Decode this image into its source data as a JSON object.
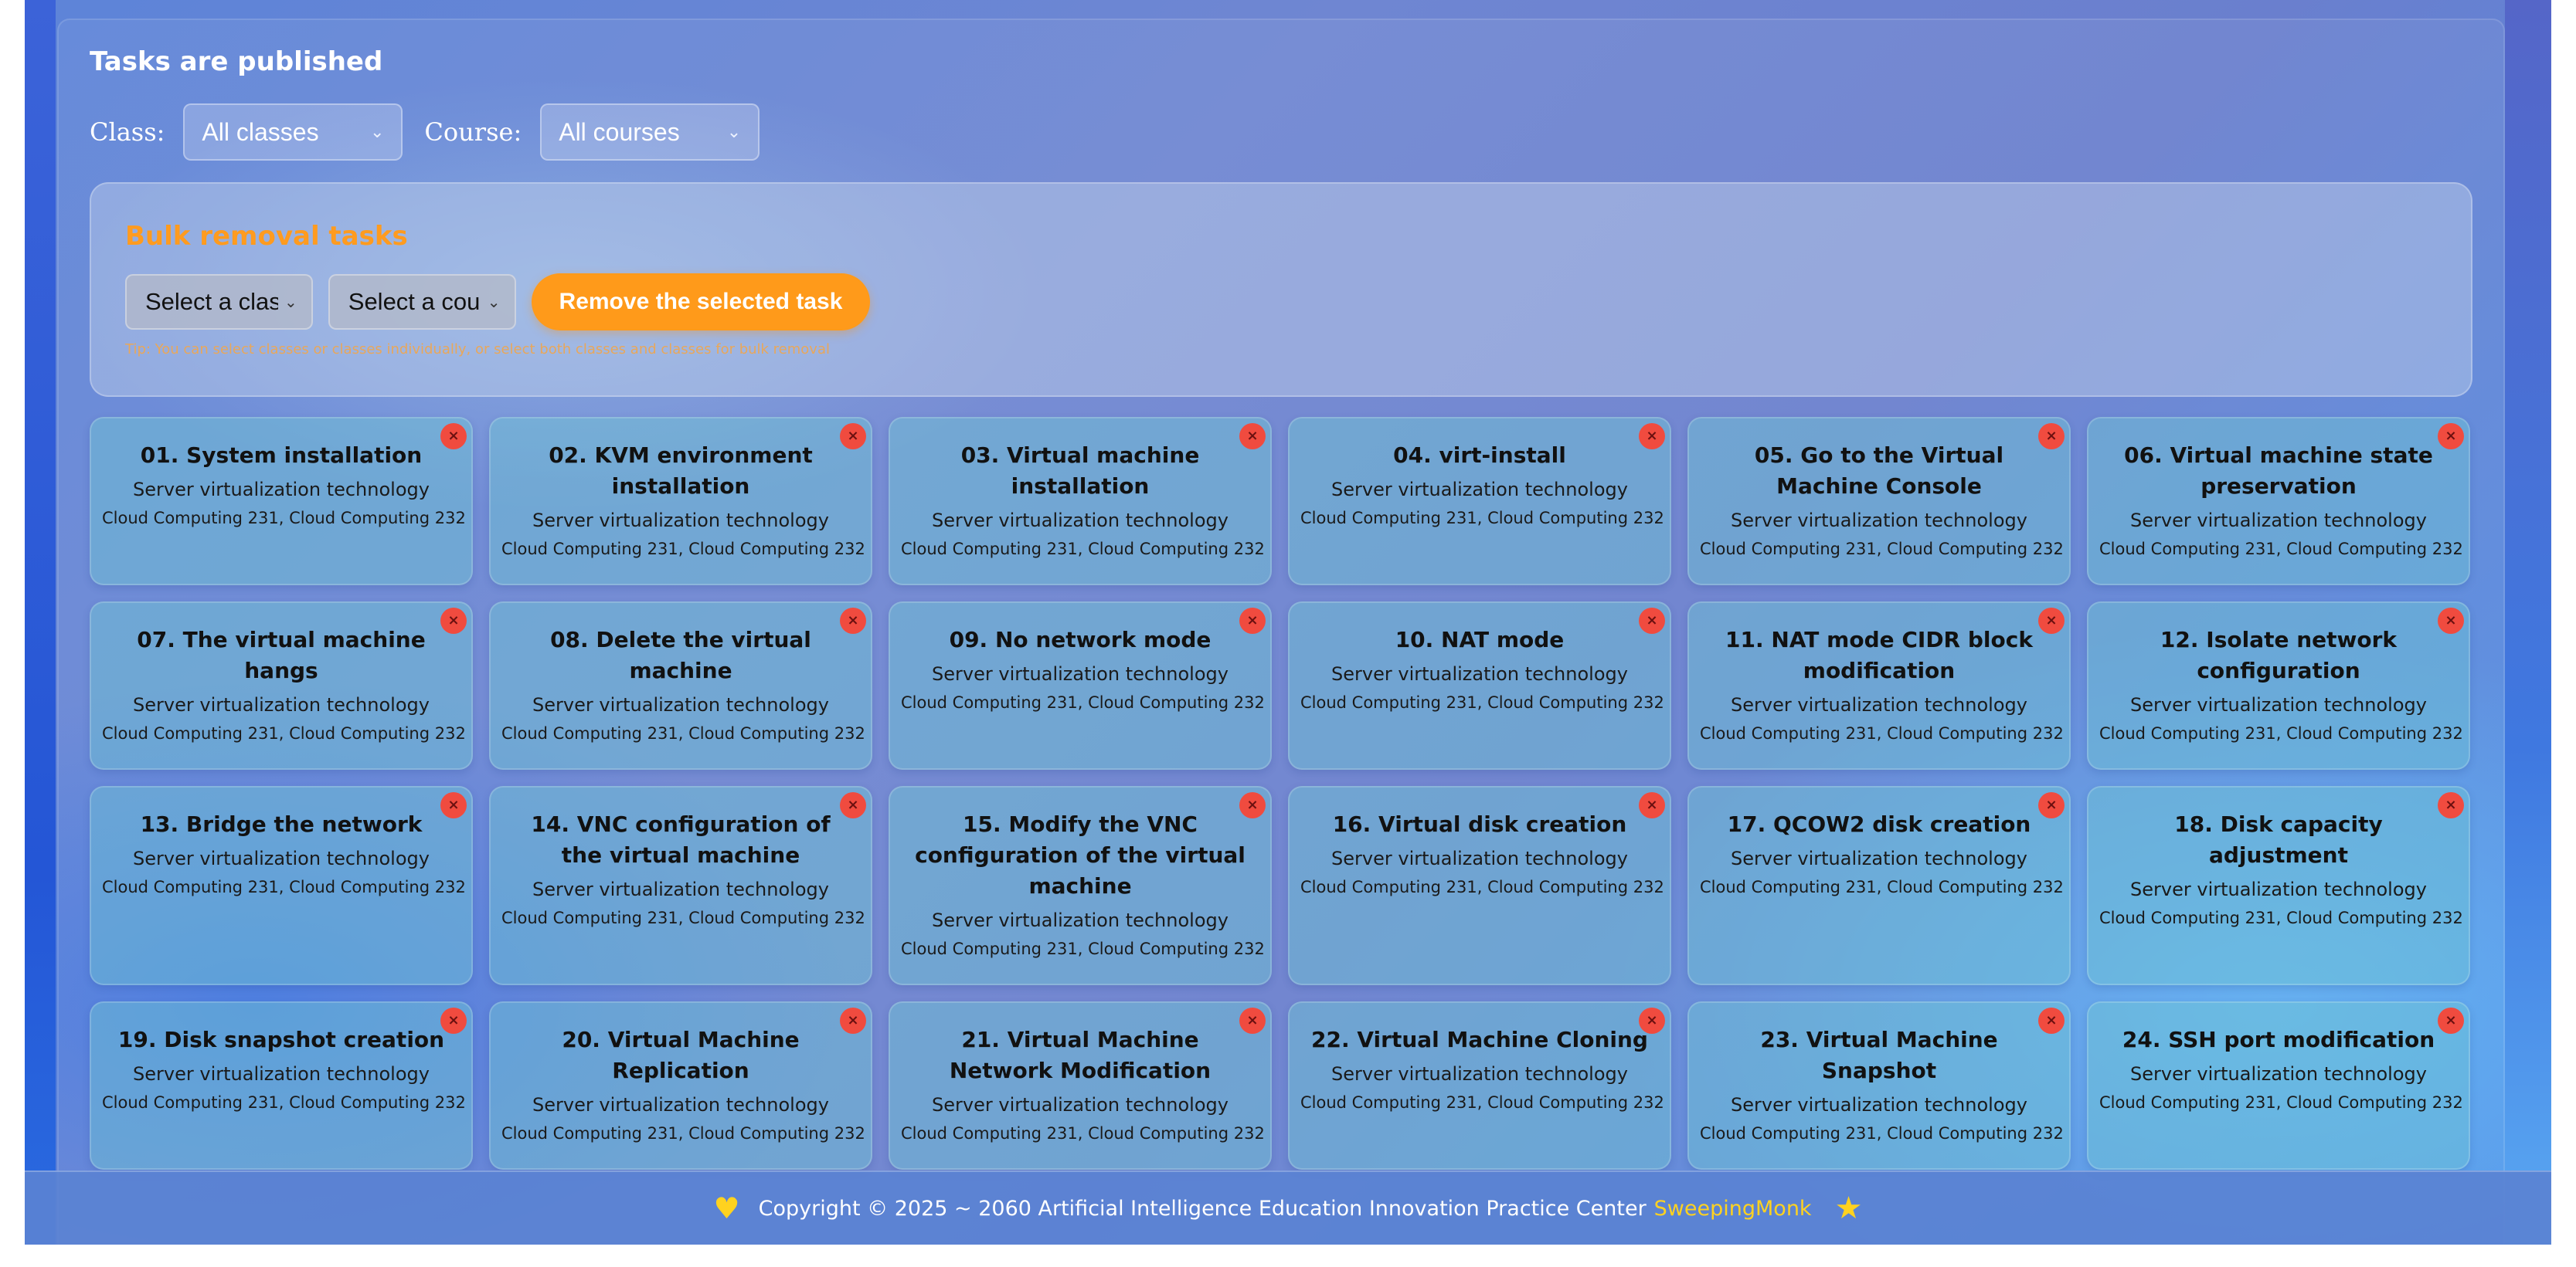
{
  "header": {
    "title": "Tasks are published",
    "class_label": "Class:",
    "class_value": "All classes",
    "course_label": "Course:",
    "course_value": "All courses"
  },
  "bulk": {
    "title": "Bulk removal tasks",
    "class_placeholder": "Select a clas",
    "course_placeholder": "Select a cou",
    "remove_label": "Remove the selected task",
    "tip": "Tip: You can select classes or classes individually, or select both classes and classes for bulk removal"
  },
  "colors": {
    "accent": "#ff9a1a",
    "delete": "#f04b3f",
    "brand": "#ffd21f"
  },
  "tasks": [
    {
      "title": "01. System installation",
      "course": "Server virtualization technology",
      "classes": "Cloud Computing 231, Cloud Computing 232"
    },
    {
      "title": "02. KVM environment installation",
      "course": "Server virtualization technology",
      "classes": "Cloud Computing 231, Cloud Computing 232"
    },
    {
      "title": "03. Virtual machine installation",
      "course": "Server virtualization technology",
      "classes": "Cloud Computing 231, Cloud Computing 232"
    },
    {
      "title": "04. virt-install",
      "course": "Server virtualization technology",
      "classes": "Cloud Computing 231, Cloud Computing 232"
    },
    {
      "title": "05. Go to the Virtual Machine Console",
      "course": "Server virtualization technology",
      "classes": "Cloud Computing 231, Cloud Computing 232"
    },
    {
      "title": "06. Virtual machine state preservation",
      "course": "Server virtualization technology",
      "classes": "Cloud Computing 231, Cloud Computing 232"
    },
    {
      "title": "07. The virtual machine hangs",
      "course": "Server virtualization technology",
      "classes": "Cloud Computing 231, Cloud Computing 232"
    },
    {
      "title": "08. Delete the virtual machine",
      "course": "Server virtualization technology",
      "classes": "Cloud Computing 231, Cloud Computing 232"
    },
    {
      "title": "09. No network mode",
      "course": "Server virtualization technology",
      "classes": "Cloud Computing 231, Cloud Computing 232"
    },
    {
      "title": "10. NAT mode",
      "course": "Server virtualization technology",
      "classes": "Cloud Computing 231, Cloud Computing 232"
    },
    {
      "title": "11. NAT mode CIDR block modification",
      "course": "Server virtualization technology",
      "classes": "Cloud Computing 231, Cloud Computing 232"
    },
    {
      "title": "12. Isolate network configuration",
      "course": "Server virtualization technology",
      "classes": "Cloud Computing 231, Cloud Computing 232"
    },
    {
      "title": "13. Bridge the network",
      "course": "Server virtualization technology",
      "classes": "Cloud Computing 231, Cloud Computing 232"
    },
    {
      "title": "14. VNC configuration of the virtual machine",
      "course": "Server virtualization technology",
      "classes": "Cloud Computing 231, Cloud Computing 232"
    },
    {
      "title": "15. Modify the VNC configuration of the virtual machine",
      "course": "Server virtualization technology",
      "classes": "Cloud Computing 231, Cloud Computing 232"
    },
    {
      "title": "16. Virtual disk creation",
      "course": "Server virtualization technology",
      "classes": "Cloud Computing 231, Cloud Computing 232"
    },
    {
      "title": "17. QCOW2 disk creation",
      "course": "Server virtualization technology",
      "classes": "Cloud Computing 231, Cloud Computing 232"
    },
    {
      "title": "18. Disk capacity adjustment",
      "course": "Server virtualization technology",
      "classes": "Cloud Computing 231, Cloud Computing 232"
    },
    {
      "title": "19. Disk snapshot creation",
      "course": "Server virtualization technology",
      "classes": "Cloud Computing 231, Cloud Computing 232"
    },
    {
      "title": "20. Virtual Machine Replication",
      "course": "Server virtualization technology",
      "classes": "Cloud Computing 231, Cloud Computing 232"
    },
    {
      "title": "21. Virtual Machine Network Modification",
      "course": "Server virtualization technology",
      "classes": "Cloud Computing 231, Cloud Computing 232"
    },
    {
      "title": "22. Virtual Machine Cloning",
      "course": "Server virtualization technology",
      "classes": "Cloud Computing 231, Cloud Computing 232"
    },
    {
      "title": "23. Virtual Machine Snapshot",
      "course": "Server virtualization technology",
      "classes": "Cloud Computing 231, Cloud Computing 232"
    },
    {
      "title": "24. SSH port modification",
      "course": "Server virtualization technology",
      "classes": "Cloud Computing 231, Cloud Computing 232"
    }
  ],
  "delete_glyph": "×",
  "footer": {
    "heart_icon": "heart-icon",
    "text": "Copyright © 2025 ~ 2060 Artificial Intelligence Education Innovation Practice Center",
    "brand": "SweepingMonk",
    "star_icon": "star-icon"
  }
}
